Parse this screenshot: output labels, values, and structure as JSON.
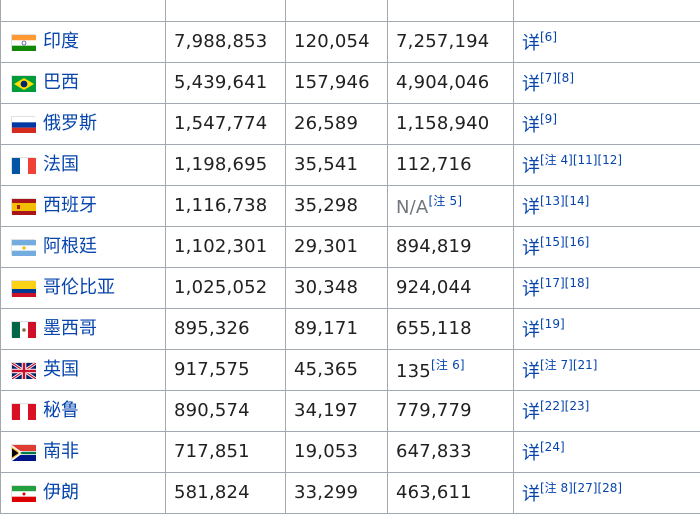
{
  "table": {
    "rows": [
      {
        "country": "",
        "flag": "none",
        "cases": "",
        "deaths": "",
        "recovered": "",
        "recovered_note": "",
        "detail": "",
        "refs": ""
      },
      {
        "country": "印度",
        "flag": "india",
        "cases": "7,988,853",
        "deaths": "120,054",
        "recovered": "7,257,194",
        "recovered_note": "",
        "detail": "详",
        "refs": "[6]"
      },
      {
        "country": "巴西",
        "flag": "brazil",
        "cases": "5,439,641",
        "deaths": "157,946",
        "recovered": "4,904,046",
        "recovered_note": "",
        "detail": "详",
        "refs": "[7][8]"
      },
      {
        "country": "俄罗斯",
        "flag": "russia",
        "cases": "1,547,774",
        "deaths": "26,589",
        "recovered": "1,158,940",
        "recovered_note": "",
        "detail": "详",
        "refs": "[9]"
      },
      {
        "country": "法国",
        "flag": "france",
        "cases": "1,198,695",
        "deaths": "35,541",
        "recovered": "112,716",
        "recovered_note": "",
        "detail": "详",
        "refs": "[注 4][11][12]"
      },
      {
        "country": "西班牙",
        "flag": "spain",
        "cases": "1,116,738",
        "deaths": "35,298",
        "recovered": "N/A",
        "recovered_note": "[注 5]",
        "detail": "详",
        "refs": "[13][14]"
      },
      {
        "country": "阿根廷",
        "flag": "argentina",
        "cases": "1,102,301",
        "deaths": "29,301",
        "recovered": "894,819",
        "recovered_note": "",
        "detail": "详",
        "refs": "[15][16]"
      },
      {
        "country": "哥伦比亚",
        "flag": "colombia",
        "cases": "1,025,052",
        "deaths": "30,348",
        "recovered": "924,044",
        "recovered_note": "",
        "detail": "详",
        "refs": "[17][18]"
      },
      {
        "country": "墨西哥",
        "flag": "mexico",
        "cases": "895,326",
        "deaths": "89,171",
        "recovered": "655,118",
        "recovered_note": "",
        "detail": "详",
        "refs": "[19]"
      },
      {
        "country": "英国",
        "flag": "uk",
        "cases": "917,575",
        "deaths": "45,365",
        "recovered": "135",
        "recovered_note": "[注 6]",
        "detail": "详",
        "refs": "[注 7][21]"
      },
      {
        "country": "秘鲁",
        "flag": "peru",
        "cases": "890,574",
        "deaths": "34,197",
        "recovered": "779,779",
        "recovered_note": "",
        "detail": "详",
        "refs": "[22][23]"
      },
      {
        "country": "南非",
        "flag": "south-africa",
        "cases": "717,851",
        "deaths": "19,053",
        "recovered": "647,833",
        "recovered_note": "",
        "detail": "详",
        "refs": "[24]"
      },
      {
        "country": "伊朗",
        "flag": "iran",
        "cases": "581,824",
        "deaths": "33,299",
        "recovered": "463,611",
        "recovered_note": "",
        "detail": "详",
        "refs": "[注 8][27][28]"
      }
    ]
  },
  "colors": {
    "link": "#0645ad",
    "border": "#a2a9b1",
    "muted": "#72777d"
  }
}
